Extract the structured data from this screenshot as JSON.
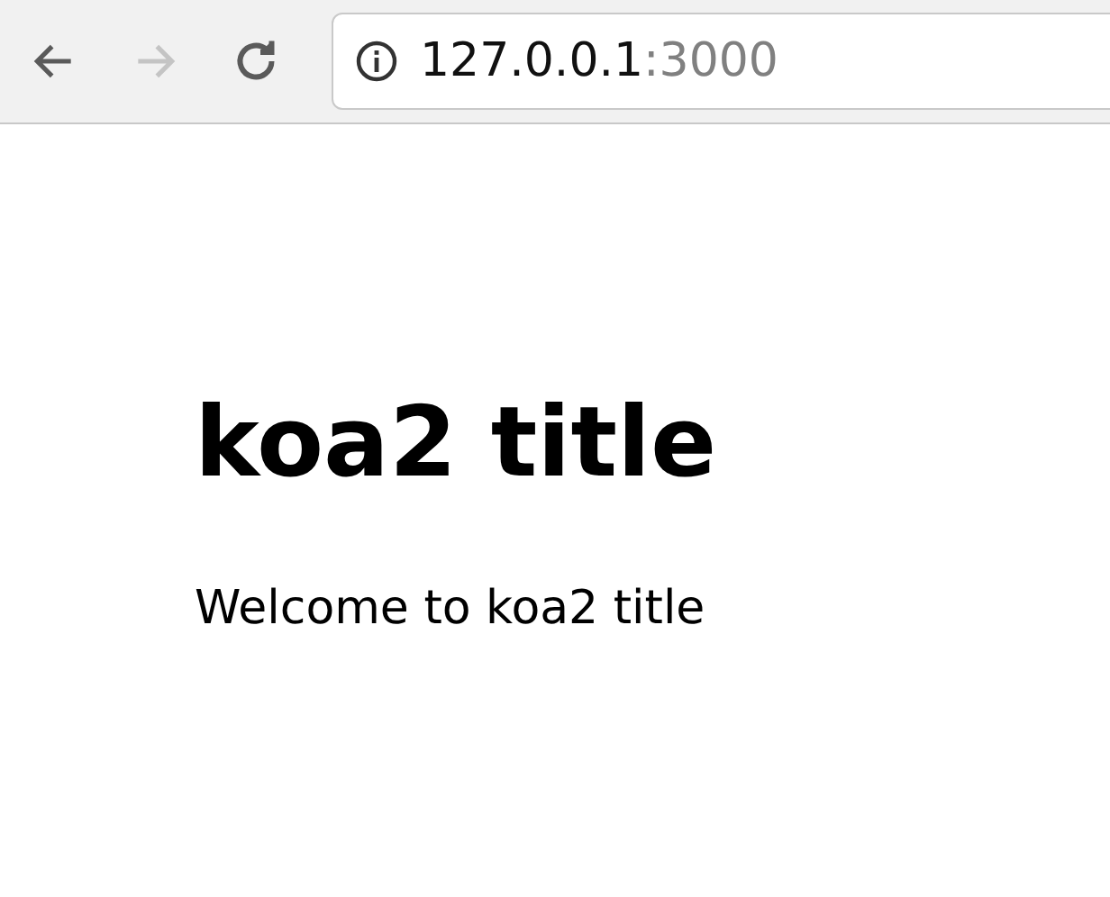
{
  "toolbar": {
    "nav_buttons": [
      {
        "kind": "back",
        "disabled": false
      },
      {
        "kind": "forward",
        "disabled": true
      },
      {
        "kind": "reload",
        "disabled": false
      }
    ],
    "address": {
      "host": "127.0.0.1",
      "port": ":3000"
    }
  },
  "page": {
    "heading": "koa2 title",
    "paragraph": "Welcome to koa2 title"
  }
}
